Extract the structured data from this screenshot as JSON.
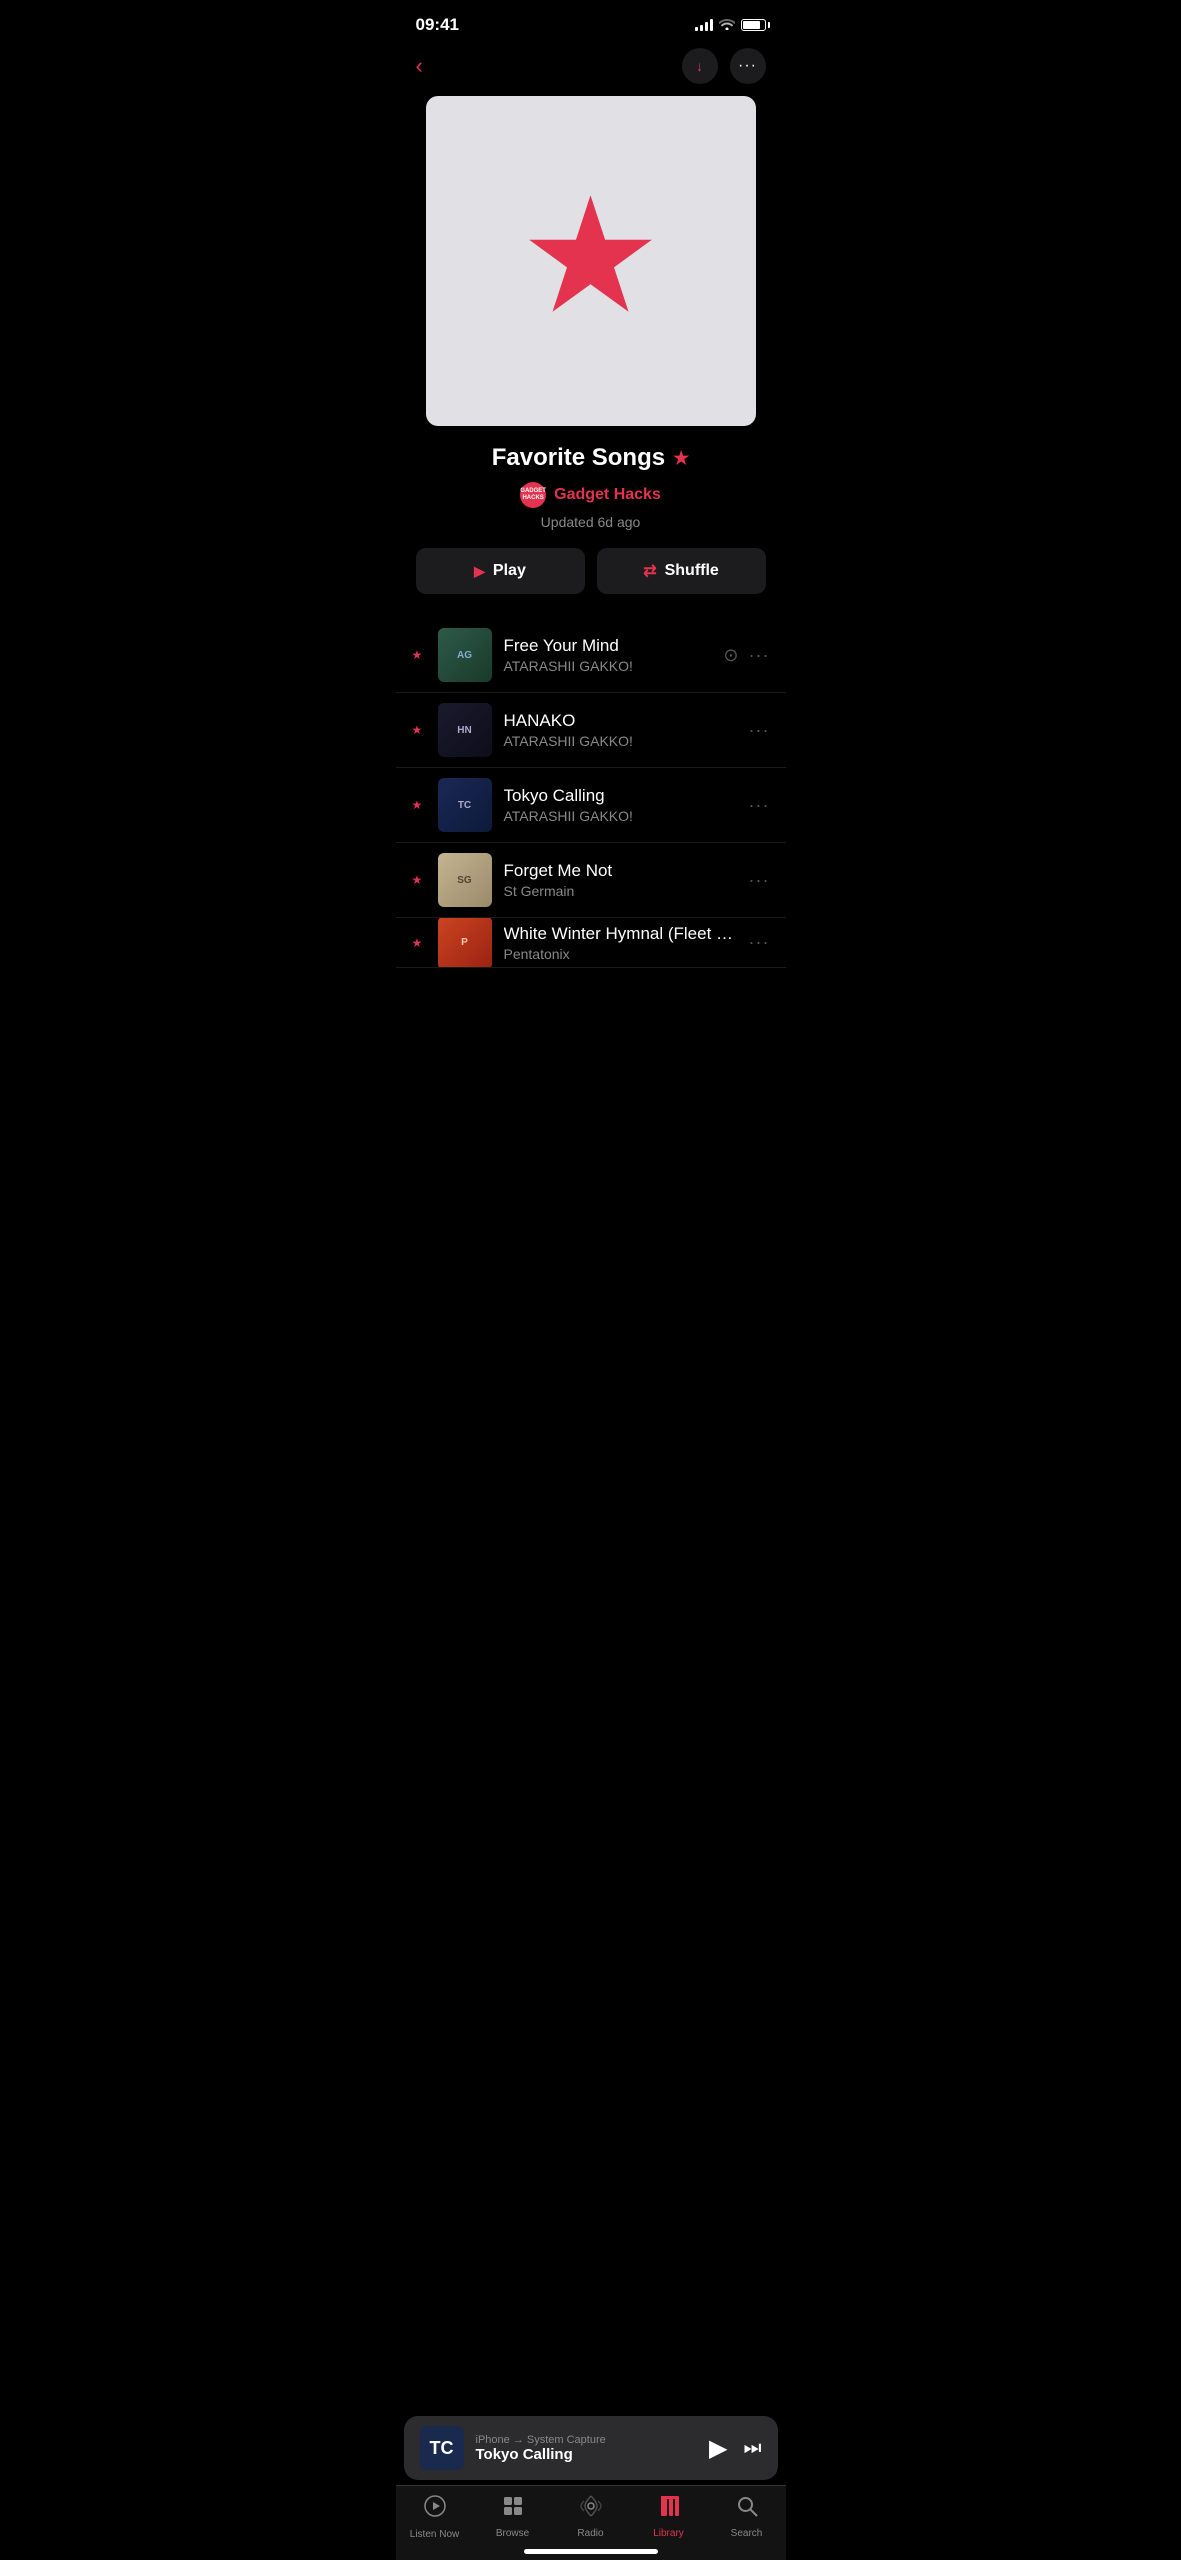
{
  "statusBar": {
    "time": "09:41"
  },
  "navBar": {
    "downloadLabel": "⬇",
    "moreLabel": "···"
  },
  "playlist": {
    "title": "Favorite Songs",
    "titleStar": "★",
    "authorName": "Gadget Hacks",
    "authorAvatarLine1": "GADGET",
    "authorAvatarLine2": "HACKS",
    "updatedText": "Updated 6d ago",
    "playLabel": "Play",
    "shuffleLabel": "Shuffle"
  },
  "tracks": [
    {
      "name": "Free Your Mind",
      "artist": "ATARASHII GAKKO!",
      "hasStar": true,
      "hasDownload": true,
      "thumbClass": "thumb-atarashii1",
      "thumbText": "AG"
    },
    {
      "name": "HANAKO",
      "artist": "ATARASHII GAKKO!",
      "hasStar": true,
      "hasDownload": false,
      "thumbClass": "thumb-atarashii2",
      "thumbText": "HN"
    },
    {
      "name": "Tokyo Calling",
      "artist": "ATARASHII GAKKO!",
      "hasStar": true,
      "hasDownload": false,
      "thumbClass": "thumb-atarashii3",
      "thumbText": "TC"
    },
    {
      "name": "Forget Me Not",
      "artist": "St Germain",
      "hasStar": true,
      "hasDownload": false,
      "thumbClass": "thumb-stgermain",
      "thumbText": "SG"
    },
    {
      "name": "White Winter Hymnal (Fleet Foxes Cover)",
      "artist": "Pentatonix",
      "hasStar": true,
      "hasDownload": false,
      "thumbClass": "thumb-pentatonix",
      "thumbText": "P",
      "partial": true
    }
  ],
  "miniPlayer": {
    "source": "iPhone → System Capture",
    "title": "Tokyo Calling",
    "thumbClass": "thumb-atarashii3",
    "thumbText": "TC"
  },
  "tabBar": {
    "tabs": [
      {
        "id": "listen-now",
        "label": "Listen Now",
        "icon": "▶",
        "active": false
      },
      {
        "id": "browse",
        "label": "Browse",
        "icon": "⊞",
        "active": false
      },
      {
        "id": "radio",
        "label": "Radio",
        "icon": "📡",
        "active": false
      },
      {
        "id": "library",
        "label": "Library",
        "icon": "📚",
        "active": true
      },
      {
        "id": "search",
        "label": "Search",
        "icon": "🔍",
        "active": false
      }
    ]
  }
}
